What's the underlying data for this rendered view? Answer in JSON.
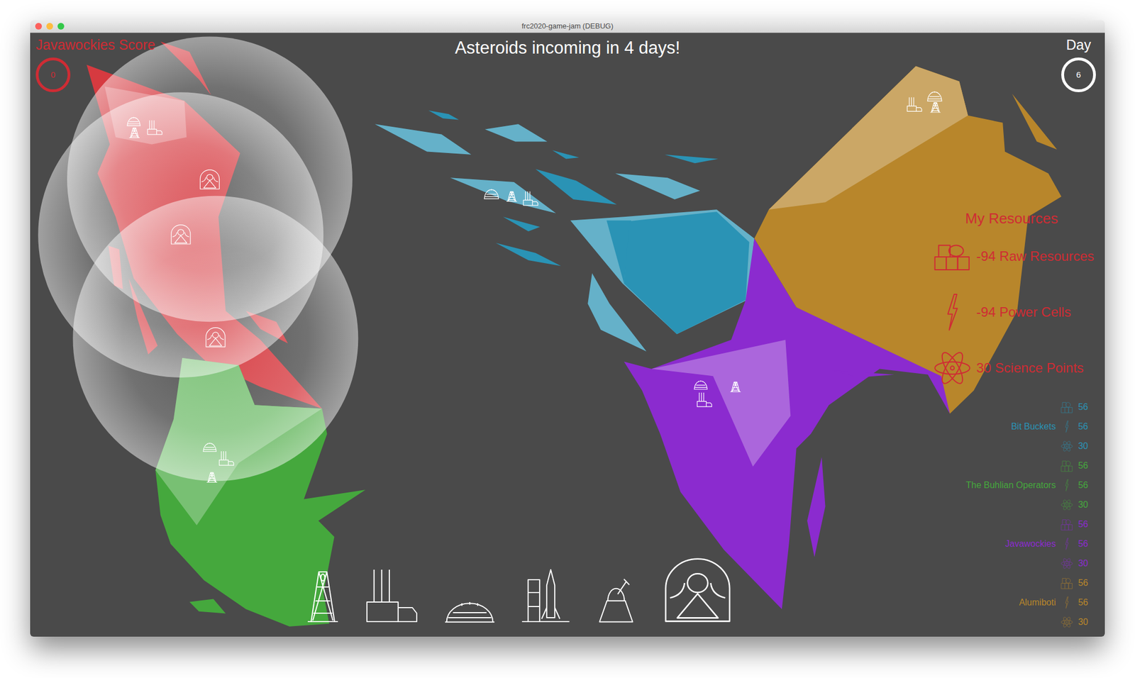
{
  "window": {
    "title": "frc2020-game-jam (DEBUG)"
  },
  "score": {
    "label": "Javawockies Score",
    "value": "0"
  },
  "headline": "Asteroids incoming in 4 days!",
  "day": {
    "label": "Day",
    "value": "6"
  },
  "my_resources": {
    "title": "My Resources",
    "items": [
      {
        "text": "-94 Raw Resources",
        "kind": "raw"
      },
      {
        "text": "-94 Power Cells",
        "kind": "power"
      },
      {
        "text": "30 Science Points",
        "kind": "science"
      }
    ]
  },
  "players": [
    {
      "name": "Bit Buckets",
      "color": "#2a93b5",
      "values": [
        "56",
        "56",
        "30"
      ]
    },
    {
      "name": "The Buhlian Operators",
      "color": "#45a83d",
      "values": [
        "56",
        "56",
        "30"
      ]
    },
    {
      "name": "Javawockies",
      "color": "#8b2bcf",
      "values": [
        "56",
        "56",
        "30"
      ]
    },
    {
      "name": "Alumiboti",
      "color": "#b8862b",
      "values": [
        "56",
        "56",
        "30"
      ]
    }
  ],
  "buildings": [
    {
      "kind": "mine",
      "selected": false
    },
    {
      "kind": "plant",
      "selected": false
    },
    {
      "kind": "dome",
      "selected": false
    },
    {
      "kind": "launcher",
      "selected": false
    },
    {
      "kind": "observatory",
      "selected": false
    },
    {
      "kind": "shield",
      "selected": true
    }
  ]
}
